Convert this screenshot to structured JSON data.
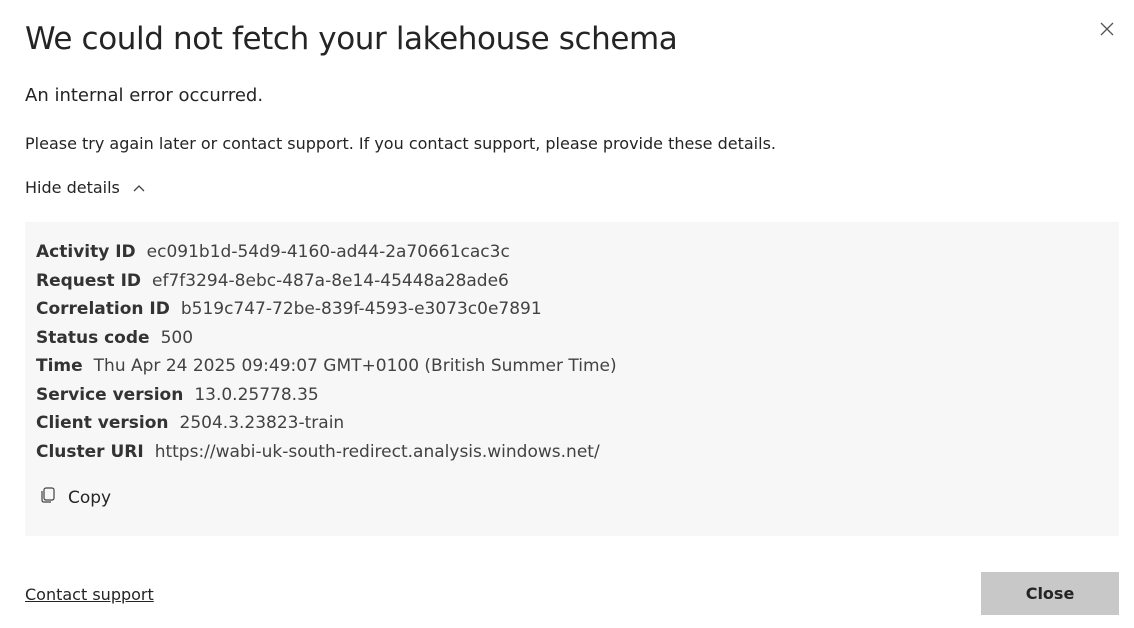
{
  "dialog": {
    "title": "We could not fetch your lakehouse schema",
    "subtitle": "An internal error occurred.",
    "message": "Please try again later or contact support. If you contact support, please provide these details.",
    "toggle_label": "Hide details",
    "close_icon": "close-icon",
    "chevron_icon": "chevron-up-icon"
  },
  "details": {
    "rows": [
      {
        "label": "Activity ID",
        "value": "ec091b1d-54d9-4160-ad44-2a70661cac3c"
      },
      {
        "label": "Request ID",
        "value": "ef7f3294-8ebc-487a-8e14-45448a28ade6"
      },
      {
        "label": "Correlation ID",
        "value": "b519c747-72be-839f-4593-e3073c0e7891"
      },
      {
        "label": "Status code",
        "value": "500"
      },
      {
        "label": "Time",
        "value": "Thu Apr 24 2025 09:49:07 GMT+0100 (British Summer Time)"
      },
      {
        "label": "Service version",
        "value": "13.0.25778.35"
      },
      {
        "label": "Client version",
        "value": "2504.3.23823-train"
      },
      {
        "label": "Cluster URI",
        "value": "https://wabi-uk-south-redirect.analysis.windows.net/"
      }
    ],
    "copy_label": "Copy",
    "copy_icon": "copy-icon"
  },
  "footer": {
    "contact_label": "Contact support",
    "close_label": "Close"
  },
  "colors": {
    "details_background": "#f7f7f7",
    "close_button": "#c8c8c8",
    "text": "#242424"
  }
}
